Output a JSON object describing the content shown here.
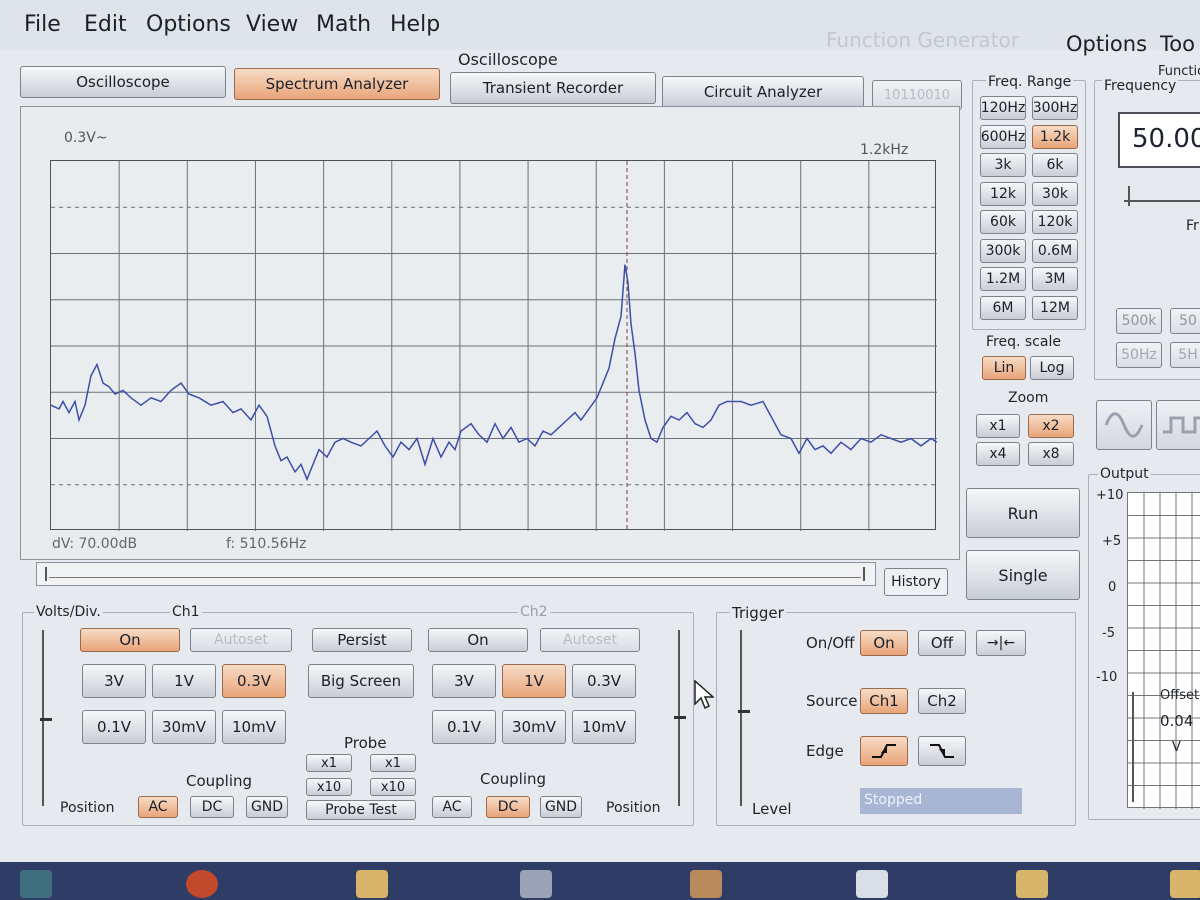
{
  "menus": [
    "File",
    "Edit",
    "Options",
    "View",
    "Math",
    "Help"
  ],
  "osc_title": "Oscilloscope",
  "fg_title": "Function Generator",
  "fg_menus": [
    "Options",
    "Too"
  ],
  "fg_partial": "Functio",
  "tabs": [
    {
      "label": "Oscilloscope",
      "active": false
    },
    {
      "label": "Spectrum Analyzer",
      "active": true
    },
    {
      "label": "Transient Recorder",
      "active": false
    },
    {
      "label": "Circuit Analyzer",
      "active": false
    }
  ],
  "tab_extra": "10110010",
  "display": {
    "vscale": "0.3V~",
    "fspan": "1.2kHz",
    "dv": "dV: 70.00dB",
    "f": "f: 510.56Hz",
    "history": "History"
  },
  "freq_range": {
    "title": "Freq. Range",
    "buttons": [
      {
        "label": "120Hz",
        "active": false
      },
      {
        "label": "300Hz",
        "active": false
      },
      {
        "label": "600Hz",
        "active": false
      },
      {
        "label": "1.2k",
        "active": true
      },
      {
        "label": "3k",
        "active": false
      },
      {
        "label": "6k",
        "active": false
      },
      {
        "label": "12k",
        "active": false
      },
      {
        "label": "30k",
        "active": false
      },
      {
        "label": "60k",
        "active": false
      },
      {
        "label": "120k",
        "active": false
      },
      {
        "label": "300k",
        "active": false
      },
      {
        "label": "0.6M",
        "active": false
      },
      {
        "label": "1.2M",
        "active": false
      },
      {
        "label": "3M",
        "active": false
      },
      {
        "label": "6M",
        "active": false
      },
      {
        "label": "12M",
        "active": false
      }
    ]
  },
  "freq_scale": {
    "title": "Freq. scale",
    "lin": "Lin",
    "log": "Log"
  },
  "zoom": {
    "title": "Zoom",
    "x1": "x1",
    "x2": "x2",
    "x4": "x4",
    "x8": "x8"
  },
  "run": "Run",
  "single": "Single",
  "ch1": {
    "volts_div": "Volts/Div.",
    "title": "Ch1",
    "on": "On",
    "autoset": "Autoset",
    "v": [
      "3V",
      "1V",
      "0.3V",
      "0.1V",
      "30mV",
      "10mV"
    ],
    "active": "0.3V",
    "coupling": "Coupling",
    "ac": "AC",
    "dc": "DC",
    "gnd": "GND",
    "position": "Position"
  },
  "mid": {
    "persist": "Persist",
    "bigscreen": "Big Screen",
    "probe": "Probe",
    "x1": "x1",
    "x10": "x10",
    "probe_test": "Probe Test"
  },
  "ch2": {
    "title": "Ch2",
    "on": "On",
    "autoset": "Autoset",
    "v": [
      "3V",
      "1V",
      "0.3V",
      "0.1V",
      "30mV",
      "10mV"
    ],
    "active": "1V",
    "coupling": "Coupling",
    "ac": "AC",
    "dc": "DC",
    "gnd": "GND",
    "position": "Position"
  },
  "trigger": {
    "title": "Trigger",
    "onoff": "On/Off",
    "on": "On",
    "off": "Off",
    "source": "Source",
    "ch1": "Ch1",
    "ch2": "Ch2",
    "edge": "Edge",
    "level": "Level",
    "status": "Stopped"
  },
  "fg": {
    "frequency": "Frequency",
    "value": "50.00",
    "fr": "Fr",
    "b500k": "500k",
    "b50": "50",
    "b50hz": "50Hz",
    "b5h": "5H",
    "output": "Output",
    "ticks": [
      "+10",
      "+5",
      "0",
      "-5",
      "-10"
    ],
    "offset": "Offset",
    "offset_val": "0.04",
    "offset_unit": "V"
  },
  "spectrum": [
    [
      0,
      0.34
    ],
    [
      8,
      0.33
    ],
    [
      12,
      0.35
    ],
    [
      18,
      0.32
    ],
    [
      24,
      0.35
    ],
    [
      28,
      0.3
    ],
    [
      34,
      0.34
    ],
    [
      40,
      0.42
    ],
    [
      46,
      0.45
    ],
    [
      52,
      0.4
    ],
    [
      58,
      0.39
    ],
    [
      64,
      0.37
    ],
    [
      72,
      0.38
    ],
    [
      80,
      0.36
    ],
    [
      90,
      0.34
    ],
    [
      100,
      0.36
    ],
    [
      110,
      0.35
    ],
    [
      120,
      0.38
    ],
    [
      130,
      0.4
    ],
    [
      138,
      0.37
    ],
    [
      148,
      0.36
    ],
    [
      160,
      0.34
    ],
    [
      172,
      0.35
    ],
    [
      182,
      0.32
    ],
    [
      190,
      0.33
    ],
    [
      200,
      0.3
    ],
    [
      208,
      0.34
    ],
    [
      216,
      0.31
    ],
    [
      224,
      0.23
    ],
    [
      230,
      0.19
    ],
    [
      236,
      0.2
    ],
    [
      244,
      0.16
    ],
    [
      250,
      0.18
    ],
    [
      256,
      0.14
    ],
    [
      262,
      0.18
    ],
    [
      268,
      0.22
    ],
    [
      276,
      0.2
    ],
    [
      284,
      0.24
    ],
    [
      292,
      0.25
    ],
    [
      300,
      0.24
    ],
    [
      310,
      0.23
    ],
    [
      318,
      0.25
    ],
    [
      326,
      0.27
    ],
    [
      334,
      0.23
    ],
    [
      342,
      0.2
    ],
    [
      350,
      0.24
    ],
    [
      358,
      0.22
    ],
    [
      366,
      0.25
    ],
    [
      374,
      0.18
    ],
    [
      382,
      0.25
    ],
    [
      390,
      0.2
    ],
    [
      398,
      0.24
    ],
    [
      404,
      0.22
    ],
    [
      410,
      0.27
    ],
    [
      420,
      0.29
    ],
    [
      428,
      0.26
    ],
    [
      436,
      0.24
    ],
    [
      444,
      0.29
    ],
    [
      452,
      0.25
    ],
    [
      460,
      0.28
    ],
    [
      468,
      0.24
    ],
    [
      476,
      0.25
    ],
    [
      484,
      0.23
    ],
    [
      492,
      0.27
    ],
    [
      500,
      0.26
    ],
    [
      508,
      0.28
    ],
    [
      516,
      0.3
    ],
    [
      524,
      0.32
    ],
    [
      530,
      0.3
    ],
    [
      538,
      0.33
    ],
    [
      546,
      0.36
    ],
    [
      552,
      0.4
    ],
    [
      558,
      0.44
    ],
    [
      564,
      0.52
    ],
    [
      570,
      0.58
    ],
    [
      574,
      0.72
    ],
    [
      577,
      0.67
    ],
    [
      580,
      0.56
    ],
    [
      584,
      0.48
    ],
    [
      588,
      0.38
    ],
    [
      594,
      0.3
    ],
    [
      600,
      0.25
    ],
    [
      606,
      0.24
    ],
    [
      612,
      0.28
    ],
    [
      620,
      0.31
    ],
    [
      628,
      0.3
    ],
    [
      636,
      0.32
    ],
    [
      644,
      0.29
    ],
    [
      652,
      0.28
    ],
    [
      660,
      0.3
    ],
    [
      668,
      0.34
    ],
    [
      676,
      0.35
    ],
    [
      690,
      0.35
    ],
    [
      700,
      0.34
    ],
    [
      712,
      0.35
    ],
    [
      720,
      0.31
    ],
    [
      730,
      0.26
    ],
    [
      740,
      0.25
    ],
    [
      748,
      0.21
    ],
    [
      756,
      0.25
    ],
    [
      764,
      0.22
    ],
    [
      772,
      0.23
    ],
    [
      780,
      0.21
    ],
    [
      790,
      0.24
    ],
    [
      800,
      0.22
    ],
    [
      810,
      0.25
    ],
    [
      820,
      0.24
    ],
    [
      830,
      0.26
    ],
    [
      840,
      0.25
    ],
    [
      850,
      0.24
    ],
    [
      860,
      0.25
    ],
    [
      870,
      0.23
    ],
    [
      880,
      0.25
    ],
    [
      886,
      0.24
    ]
  ]
}
